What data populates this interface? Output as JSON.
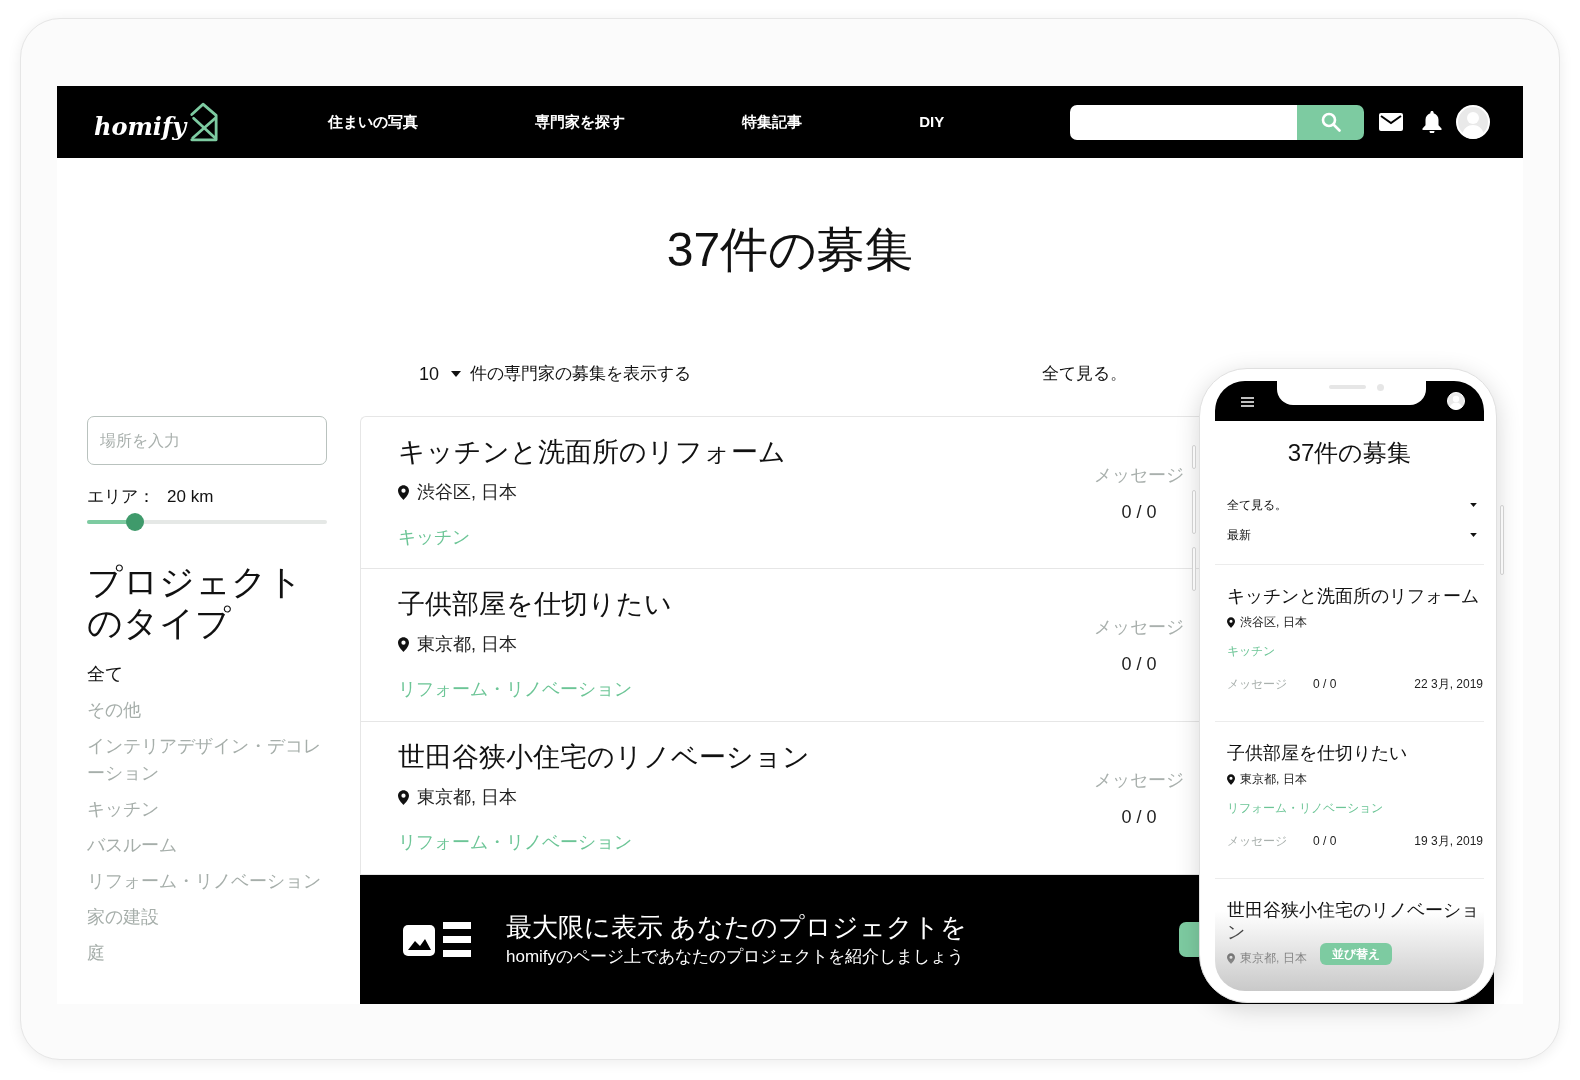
{
  "navbar": {
    "logo": "homify",
    "links": [
      "住まいの写真",
      "専門家を探す",
      "特集記事",
      "DIY"
    ]
  },
  "page_title": "37件の募集",
  "list_controls": {
    "per_page": "10",
    "label": "件の専門家の募集を表示する",
    "filter": "全て見る。"
  },
  "sidebar": {
    "location": {
      "placeholder": "場所を入力"
    },
    "area": {
      "label": "エリア：",
      "value": "20 km",
      "level": 0.2
    },
    "heading": "プロジェクトのタイプ",
    "types": [
      {
        "label": "全て",
        "selected": true
      },
      {
        "label": "その他",
        "selected": false
      },
      {
        "label": "インテリアデザイン・デコレーション",
        "selected": false
      },
      {
        "label": "キッチン",
        "selected": false
      },
      {
        "label": "バスルーム",
        "selected": false
      },
      {
        "label": "リフォーム・リノベーション",
        "selected": false
      },
      {
        "label": "家の建設",
        "selected": false
      },
      {
        "label": "庭",
        "selected": false
      }
    ]
  },
  "projects": [
    {
      "title": "キッチンと洗面所のリフォーム",
      "location": "渋谷区, 日本",
      "category": "キッチン",
      "messages_label": "メッセージ",
      "messages": "0 / 0"
    },
    {
      "title": "子供部屋を仕切りたい",
      "location": "東京都, 日本",
      "category": "リフォーム・リノベーション",
      "messages_label": "メッセージ",
      "messages": "0 / 0"
    },
    {
      "title": "世田谷狭小住宅のリノベーション",
      "location": "東京都, 日本",
      "category": "リフォーム・リノベーション",
      "messages_label": "メッセージ",
      "messages": "0 / 0"
    }
  ],
  "banner": {
    "title": "最大限に表示 あなたのプロジェクトを",
    "subtitle": "homifyのページ上であなたのプロジェクトを紹介しましょう"
  },
  "phone": {
    "title": "37件の募集",
    "filters": [
      "全て見る。",
      "最新"
    ],
    "projects": [
      {
        "title": "キッチンと洗面所のリフォーム",
        "location": "渋谷区, 日本",
        "category": "キッチン",
        "messages_label": "メッセージ",
        "messages": "0 / 0",
        "date": "22 3月, 2019"
      },
      {
        "title": "子供部屋を仕切りたい",
        "location": "東京都, 日本",
        "category": "リフォーム・リノベーション",
        "messages_label": "メッセージ",
        "messages": "0 / 0",
        "date": "19 3月, 2019"
      },
      {
        "title": "世田谷狭小住宅のリノベーション",
        "location": "東京都, 日本"
      }
    ],
    "sort_button": "並び替え"
  }
}
